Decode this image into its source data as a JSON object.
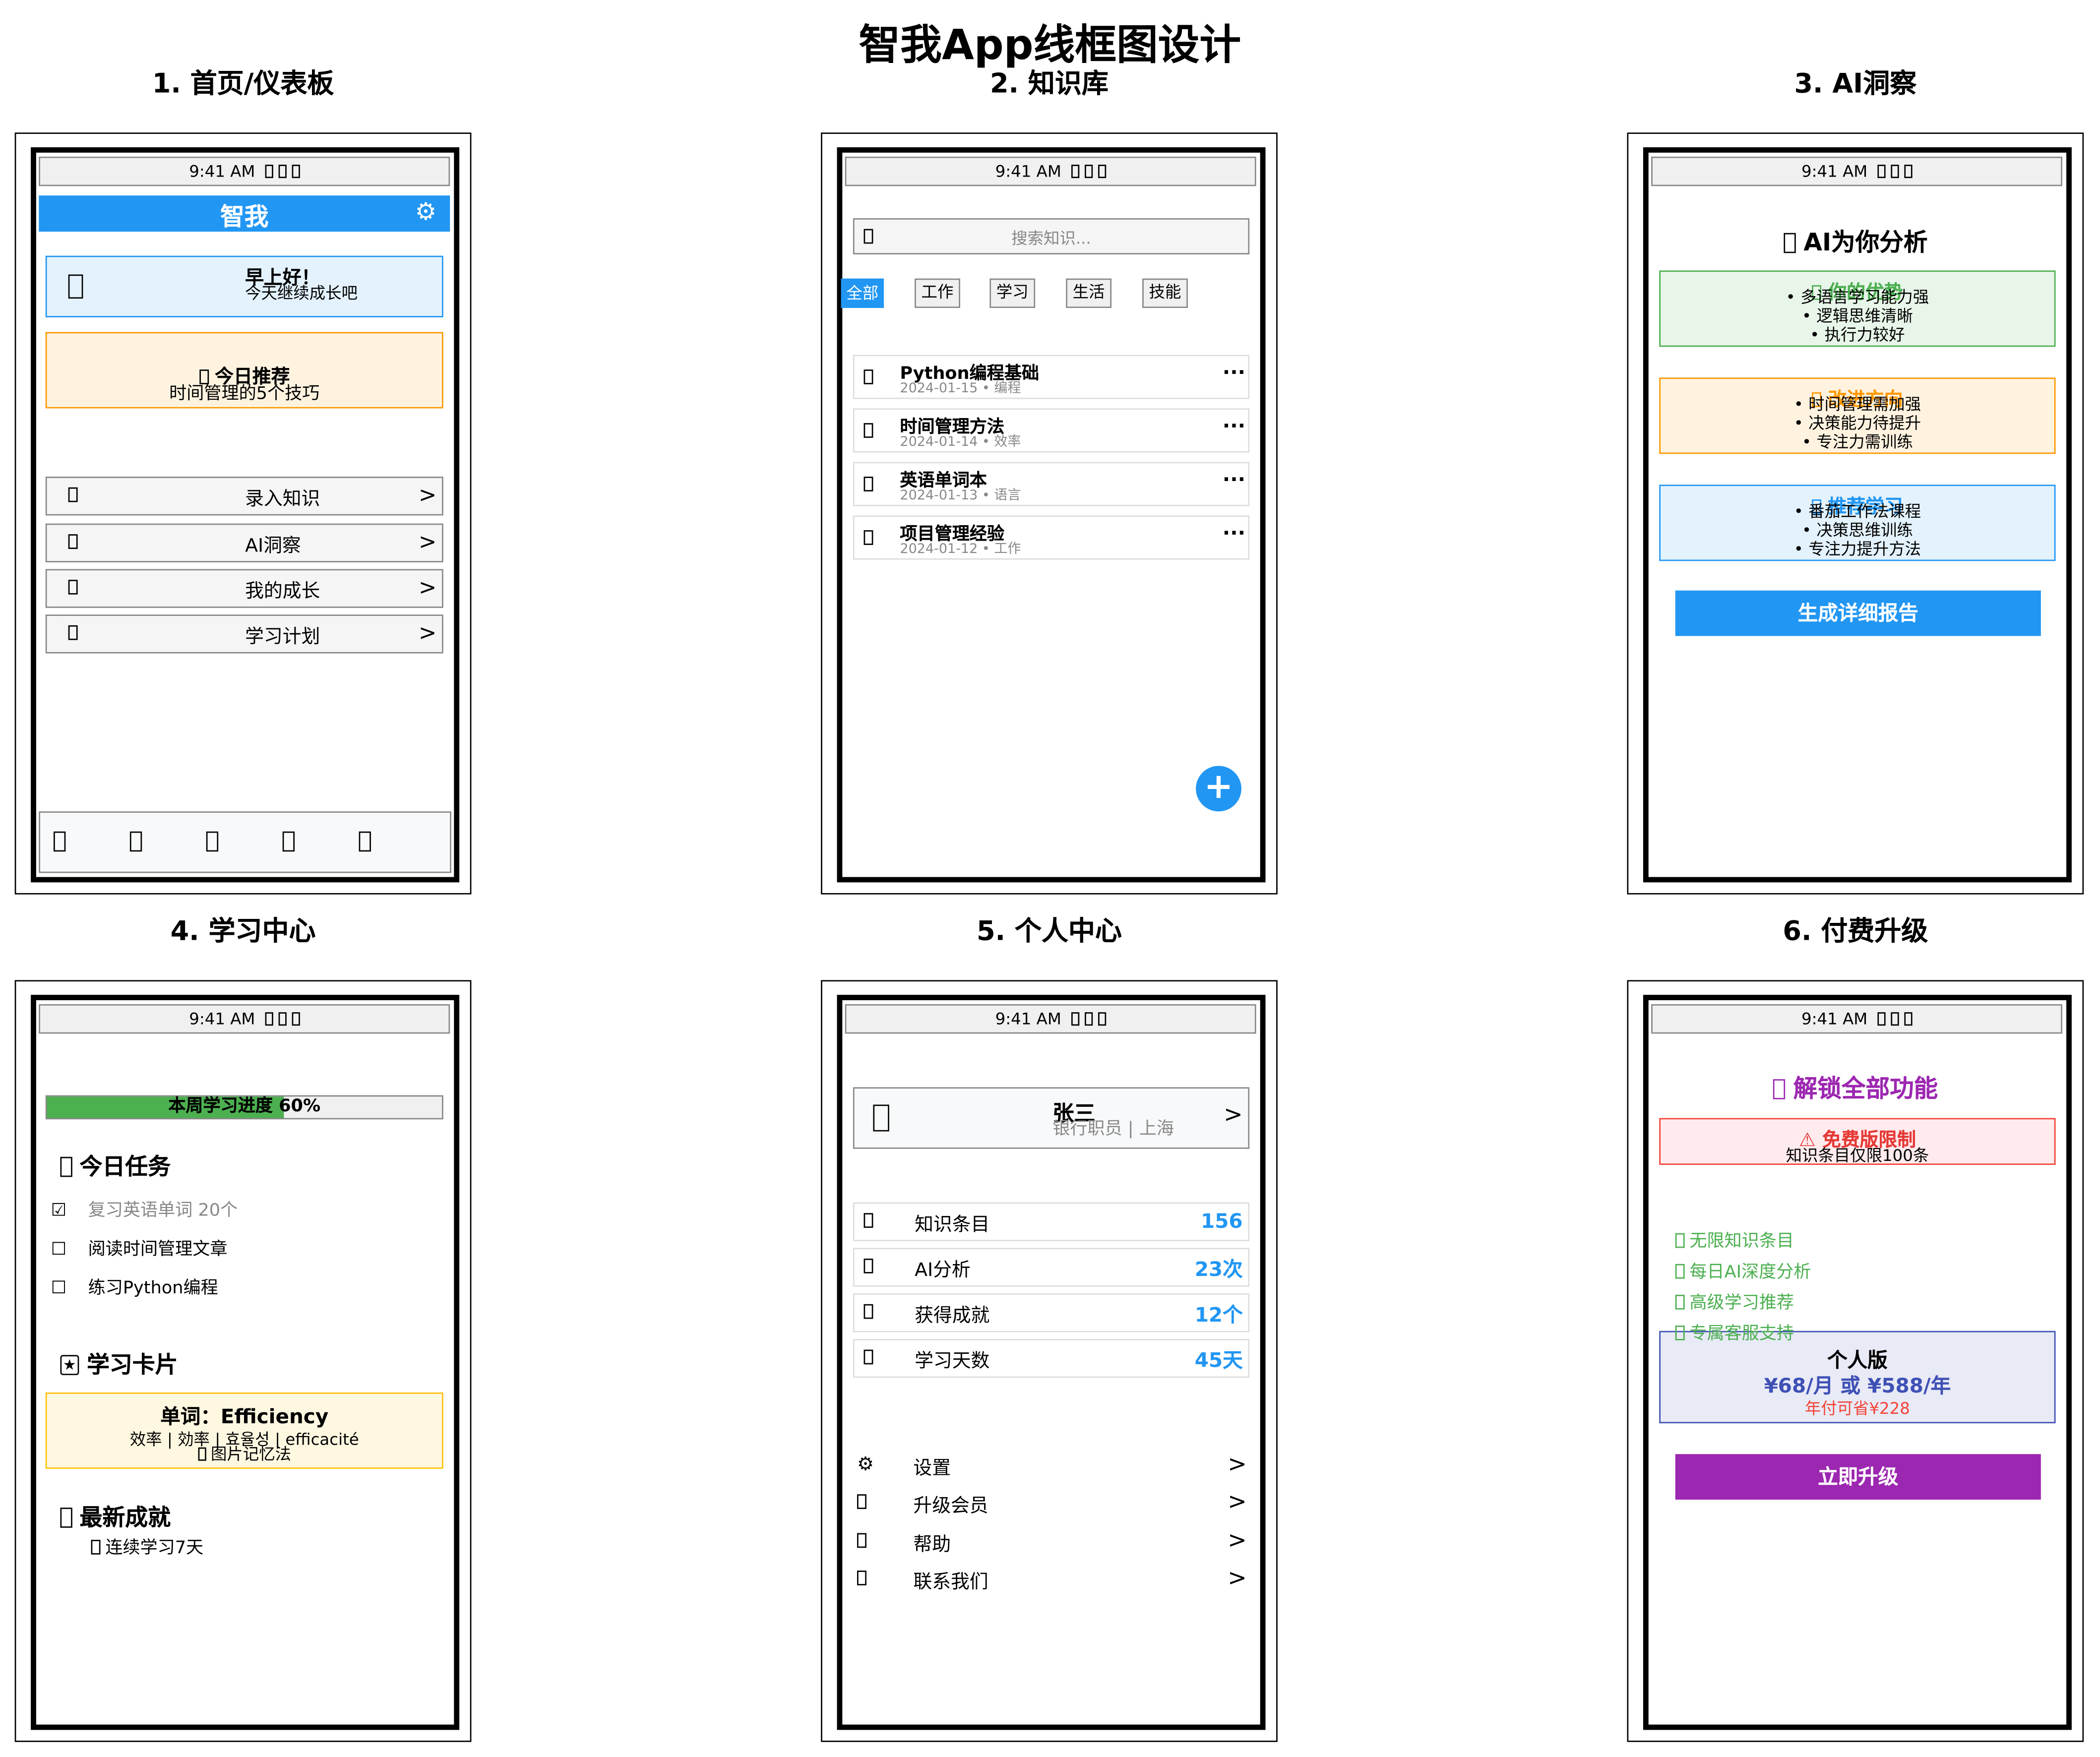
{
  "title": "智我App线框图设计",
  "status_bar": {
    "time": "9:41 AM"
  },
  "panels": {
    "home": {
      "title": "1. 首页/仪表板",
      "app_name": "智我",
      "greeting": "早上好！",
      "greeting_sub": "今天继续成长吧",
      "recommend_title": "今日推荐",
      "recommend_text": "时间管理的5个技巧",
      "menu": [
        {
          "label": "录入知识"
        },
        {
          "label": "AI洞察"
        },
        {
          "label": "我的成长"
        },
        {
          "label": "学习计划"
        }
      ],
      "chevron": ">"
    },
    "knowledge": {
      "title": "2. 知识库",
      "search_placeholder": "搜索知识...",
      "filters": [
        "全部",
        "工作",
        "学习",
        "生活",
        "技能"
      ],
      "items": [
        {
          "title": "Python编程基础",
          "meta": "2024-01-15 • 编程"
        },
        {
          "title": "时间管理方法",
          "meta": "2024-01-14 • 效率"
        },
        {
          "title": "英语单词本",
          "meta": "2024-01-13 • 语言"
        },
        {
          "title": "项目管理经验",
          "meta": "2024-01-12 • 工作"
        }
      ],
      "more": "···",
      "fab": "+"
    },
    "insight": {
      "title": "3. AI洞察",
      "heading": "AI为你分析",
      "cards": [
        {
          "title": "你的优势",
          "bullets": [
            "• 多语言学习能力强",
            "• 逻辑思维清晰",
            "• 执行力较好"
          ]
        },
        {
          "title": "改进方向",
          "bullets": [
            "• 时间管理需加强",
            "• 决策能力待提升",
            "• 专注力需训练"
          ]
        },
        {
          "title": "推荐学习",
          "bullets": [
            "• 番茄工作法课程",
            "• 决策思维训练",
            "• 专注力提升方法"
          ]
        }
      ],
      "button": "生成详细报告"
    },
    "learning": {
      "title": "4. 学习中心",
      "progress_label": "本周学习进度 60%",
      "progress": 0.6,
      "tasks_heading": "今日任务",
      "tasks": [
        {
          "text": "复习英语单词 20个",
          "done": true,
          "mark": "☑"
        },
        {
          "text": "阅读时间管理文章",
          "done": false,
          "mark": "☐"
        },
        {
          "text": "练习Python编程",
          "done": false,
          "mark": "☐"
        }
      ],
      "cards_heading": "学习卡片",
      "card_word": "单词：Efficiency",
      "card_translations": "效率 | 効率 | 효율성 | efficacité",
      "card_method": "图片记忆法",
      "achievements_heading": "最新成就",
      "achievement": "连续学习7天"
    },
    "profile": {
      "title": "5. 个人中心",
      "name": "张三",
      "subtitle": "银行职员 | 上海",
      "stats": [
        {
          "label": "知识条目",
          "value": "156"
        },
        {
          "label": "AI分析",
          "value": "23次"
        },
        {
          "label": "获得成就",
          "value": "12个"
        },
        {
          "label": "学习天数",
          "value": "45天"
        }
      ],
      "menu": [
        {
          "label": "设置"
        },
        {
          "label": "升级会员"
        },
        {
          "label": "帮助"
        },
        {
          "label": "联系我们"
        }
      ],
      "chevron": ">"
    },
    "upgrade": {
      "title": "6. 付费升级",
      "heading": "解锁全部功能",
      "limit_title": "免费版限制",
      "limit_text": "知识条目仅限100条",
      "features": [
        "无限知识条目",
        "每日AI深度分析",
        "高级学习推荐",
        "专属客服支持"
      ],
      "plan_name": "个人版",
      "plan_price": "¥68/月 或 ¥588/年",
      "plan_saving": "年付可省¥228",
      "button": "立即升级"
    }
  },
  "colors": {
    "primary": "#2196f3",
    "green": "#4caf50",
    "orange": "#ff9800",
    "red": "#f44336",
    "purple": "#9c27b0",
    "indigo": "#3f51b5",
    "yellow": "#ffc107"
  }
}
